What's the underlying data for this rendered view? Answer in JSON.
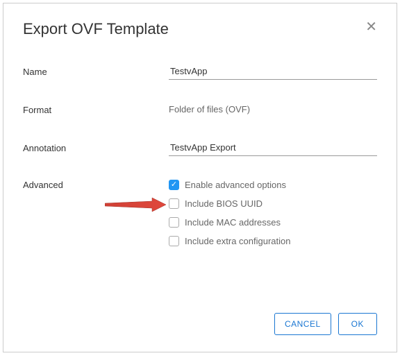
{
  "dialog": {
    "title": "Export OVF Template"
  },
  "form": {
    "name_label": "Name",
    "name_value": "TestvApp",
    "format_label": "Format",
    "format_value": "Folder of files (OVF)",
    "annotation_label": "Annotation",
    "annotation_value": "TestvApp Export",
    "advanced_label": "Advanced"
  },
  "advanced_options": [
    {
      "label": "Enable advanced options",
      "checked": true
    },
    {
      "label": "Include BIOS UUID",
      "checked": false
    },
    {
      "label": "Include MAC addresses",
      "checked": false
    },
    {
      "label": "Include extra configuration",
      "checked": false
    }
  ],
  "buttons": {
    "cancel": "CANCEL",
    "ok": "OK"
  }
}
